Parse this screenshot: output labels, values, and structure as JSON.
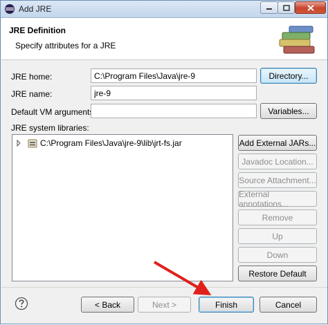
{
  "window": {
    "title": "Add JRE"
  },
  "header": {
    "title": "JRE Definition",
    "subtitle": "Specify attributes for a JRE"
  },
  "form": {
    "jre_home": {
      "label": "JRE home:",
      "value": "C:\\Program Files\\Java\\jre-9"
    },
    "jre_name": {
      "label": "JRE name:",
      "value": "jre-9"
    },
    "vm_args": {
      "label": "Default VM arguments:",
      "value": ""
    },
    "directory_button": "Directory...",
    "variables_button": "Variables..."
  },
  "libraries": {
    "label": "JRE system libraries:",
    "items": [
      {
        "path": "C:\\Program Files\\Java\\jre-9\\lib\\jrt-fs.jar"
      }
    ],
    "buttons": {
      "add_external_jars": "Add External JARs...",
      "javadoc_location": "Javadoc Location...",
      "source_attachment": "Source Attachment...",
      "external_annotations": "External annotations...",
      "remove": "Remove",
      "up": "Up",
      "down": "Down",
      "restore_default": "Restore Default"
    }
  },
  "footer": {
    "back": "< Back",
    "next": "Next >",
    "finish": "Finish",
    "cancel": "Cancel"
  },
  "colors": {
    "arrow": "#e0201b",
    "focus_border": "#3c7fb1"
  }
}
